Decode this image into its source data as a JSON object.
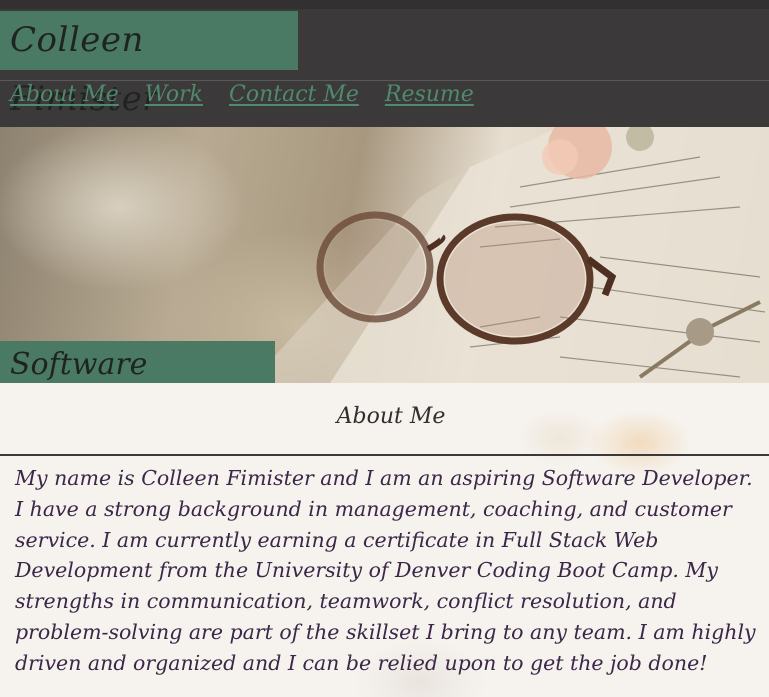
{
  "header": {
    "name": "Colleen Fimister",
    "nav": [
      "About Me",
      "Work",
      "Contact Me",
      "Resume"
    ]
  },
  "hero": {
    "role": "Software Engineer"
  },
  "about": {
    "title": "About Me",
    "bio": "My name is Colleen Fimister and I am an aspiring Software Developer. I have a strong background in management, coaching, and customer service. I am currently earning a certificate in Full Stack Web Development from the University of Denver Coding Boot Camp. My strengths in communication, teamwork, conflict resolution, and problem-solving are part of the skillset I bring to any team. I am highly driven and organized and I can be relied upon to get the job done!"
  },
  "colors": {
    "header_bg": "#3b393a",
    "accent_green": "#4a7a63",
    "nav_link": "#4f8a6d",
    "bio_text": "#3b2747"
  }
}
